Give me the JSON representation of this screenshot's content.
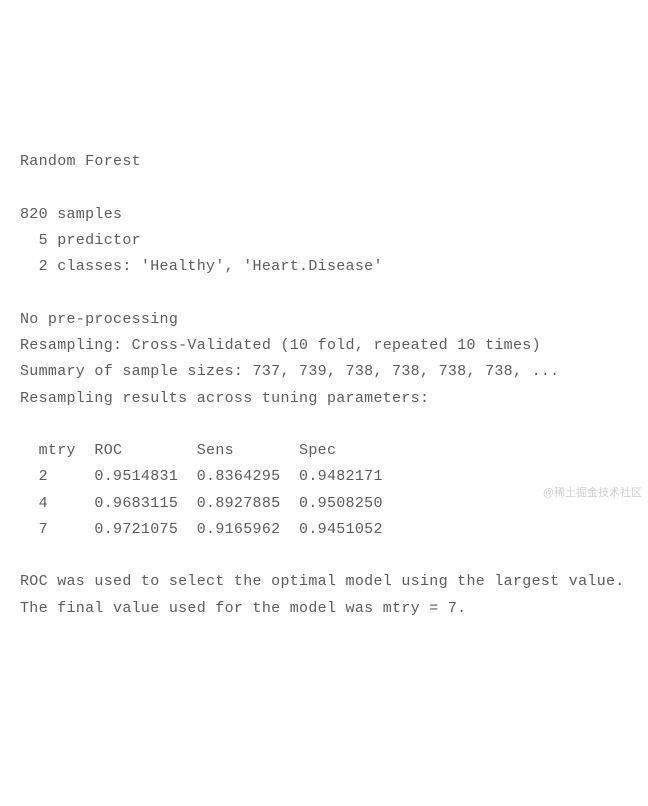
{
  "chart_data": {
    "type": "table",
    "columns": [
      "mtry",
      "ROC",
      "Sens",
      "Spec"
    ],
    "rows": [
      [
        2,
        0.9514831,
        0.8364295,
        0.9482171
      ],
      [
        4,
        0.9683115,
        0.8927885,
        0.950825
      ],
      [
        7,
        0.9721075,
        0.9165962,
        0.9451052
      ]
    ]
  },
  "title": "Random Forest",
  "samples_line": "820 samples",
  "predictor_line": "  5 predictor",
  "classes_line": "  2 classes: 'Healthy', 'Heart.Disease'",
  "preprocessing_line": "No pre-processing",
  "resampling_line": "Resampling: Cross-Validated (10 fold, repeated 10 times)",
  "summary_line": "Summary of sample sizes: 737, 739, 738, 738, 738, 738, ...",
  "results_header": "Resampling results across tuning parameters:",
  "table_header": "  mtry  ROC        Sens       Spec     ",
  "table_row1": "  2     0.9514831  0.8364295  0.9482171",
  "table_row2": "  4     0.9683115  0.8927885  0.9508250",
  "table_row3": "  7     0.9721075  0.9165962  0.9451052",
  "selection_line": "ROC was used to select the optimal model using the largest value.",
  "final_line": "The final value used for the model was mtry = 7.",
  "watermark": "@稀土掘金技术社区"
}
